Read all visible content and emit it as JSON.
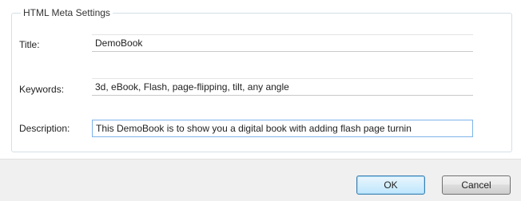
{
  "dialog": {
    "group_title": "HTML Meta Settings",
    "fields": [
      {
        "label": "Title:",
        "value": "DemoBook"
      },
      {
        "label": "Keywords:",
        "value": "3d, eBook, Flash, page-flipping, tilt, any angle"
      },
      {
        "label": "Description:",
        "value": "This DemoBook is to show you a digital book with adding flash page turnin"
      }
    ]
  },
  "buttons": {
    "ok_label": "OK",
    "cancel_label": "Cancel"
  }
}
